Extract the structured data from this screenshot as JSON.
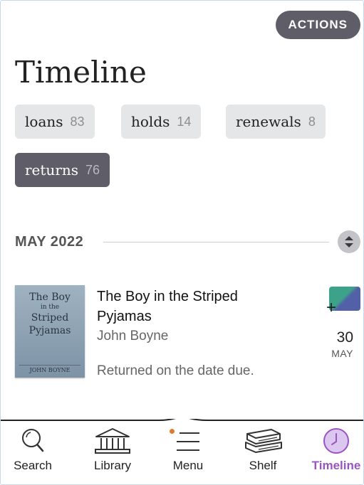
{
  "header": {
    "actions_label": "ACTIONS",
    "title": "Timeline"
  },
  "filters": [
    {
      "label": "loans",
      "count": "83",
      "selected": false
    },
    {
      "label": "holds",
      "count": "14",
      "selected": false
    },
    {
      "label": "renewals",
      "count": "8",
      "selected": false
    },
    {
      "label": "returns",
      "count": "76",
      "selected": true
    }
  ],
  "timeline": {
    "month_label": "MAY 2022",
    "sort_icon": "sort-updown-icon",
    "entries": [
      {
        "cover": {
          "title_lines": [
            "The Boy",
            "in the",
            "Striped",
            "Pyjamas"
          ],
          "author": "JOHN BOYNE"
        },
        "title": "The Boy in the Striped Pyjamas",
        "author": "John Boyne",
        "status": "Returned on the date due.",
        "day": "30",
        "month": "MAY",
        "badge_icon": "add-library-icon"
      }
    ]
  },
  "tabs": [
    {
      "label": "Search",
      "icon": "search-icon",
      "active": false
    },
    {
      "label": "Library",
      "icon": "library-icon",
      "active": false
    },
    {
      "label": "Menu",
      "icon": "menu-icon",
      "active": false,
      "badge_dot": true
    },
    {
      "label": "Shelf",
      "icon": "shelf-icon",
      "active": false
    },
    {
      "label": "Timeline",
      "icon": "clock-icon",
      "active": true
    }
  ],
  "colors": {
    "accent": "#9a55c0",
    "chip_bg": "#e4e6e8",
    "chip_active_bg": "#5f5e68",
    "notification_dot": "#e07a33"
  }
}
